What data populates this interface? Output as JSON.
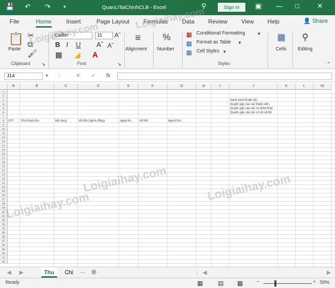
{
  "title_bar": {
    "doc_title": "QuanLiTaiChinhCLB - Excel",
    "sign_in_label": "Sign in"
  },
  "ribbon_tabs": [
    "File",
    "Home",
    "Insert",
    "Page Layout",
    "Formulas",
    "Data",
    "Review",
    "View",
    "Help"
  ],
  "share_label": "Share",
  "ribbon": {
    "paste_label": "Paste",
    "clipboard_label": "Clipboard",
    "font_name": "Calibri",
    "font_size": "11",
    "font_group_label": "Font",
    "alignment_label": "Alignment",
    "number_label": "Number",
    "conditional_formatting": "Conditional Formatting",
    "format_as_table": "Format as Table",
    "cell_styles": "Cell Styles",
    "styles_label": "Styles",
    "cells_label": "Cells",
    "editing_label": "Editing"
  },
  "formula_bar": {
    "name_box": "J14",
    "fx": "fx",
    "content": ""
  },
  "columns": [
    "A",
    "B",
    "C",
    "D",
    "E",
    "F",
    "G",
    "H",
    "I",
    "J",
    "K",
    "L",
    "M"
  ],
  "rows": [
    "1",
    "2",
    "3",
    "4",
    "5",
    "6",
    "7",
    "8",
    "9",
    "10",
    "11",
    "12",
    "13",
    "14",
    "15",
    "16",
    "17",
    "18",
    "19",
    "20",
    "21",
    "22",
    "23",
    "24",
    "25",
    "26",
    "27",
    "28",
    "29",
    "30",
    "31",
    "32",
    "33",
    "34",
    "35",
    "36",
    "37",
    "38",
    "39",
    "40",
    "41",
    "42"
  ],
  "cells": {
    "J3": "Danh sách khoản thu",
    "J4": "Quyên góp của các thành viên",
    "J5": "Quyên góp của các cá nhân khác",
    "J6": "Quyên góp của các cơ sở xã hội",
    "A8": "STT",
    "B8": "Tên khoản thu",
    "C8": "Nội dung",
    "D8": "Số tiền (nghìn đồng)",
    "E8": "Ngày thu",
    "F8": "Số tiền",
    "G8": "Người thu"
  },
  "sheets": [
    {
      "name": "Thu",
      "active": true
    },
    {
      "name": "Chi",
      "active": false
    }
  ],
  "status": {
    "ready": "Ready",
    "zoom": "59%"
  },
  "watermark": "Loigiaihay.com"
}
